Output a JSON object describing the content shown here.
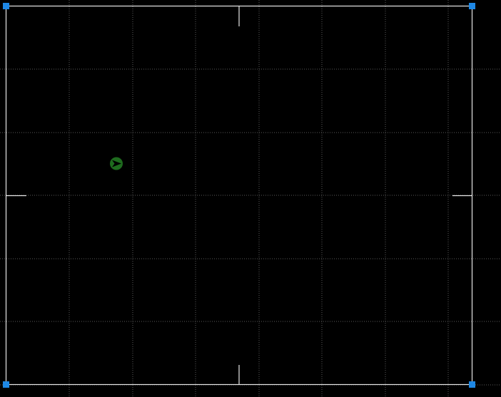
{
  "canvas": {
    "background_color": "#000000",
    "grid_color": "#5a5a5a",
    "grid_visible": true,
    "frame_color": "#e6e6e6",
    "handle_color": "#1e88e5",
    "handles": [
      "top-left",
      "top-right",
      "bottom-left",
      "bottom-right"
    ],
    "center_marks": [
      "top",
      "bottom",
      "left",
      "right"
    ],
    "marker": {
      "icon": "arrow-right-icon",
      "fill_color": "#1e6b1e",
      "glyph_color": "#000000"
    }
  }
}
